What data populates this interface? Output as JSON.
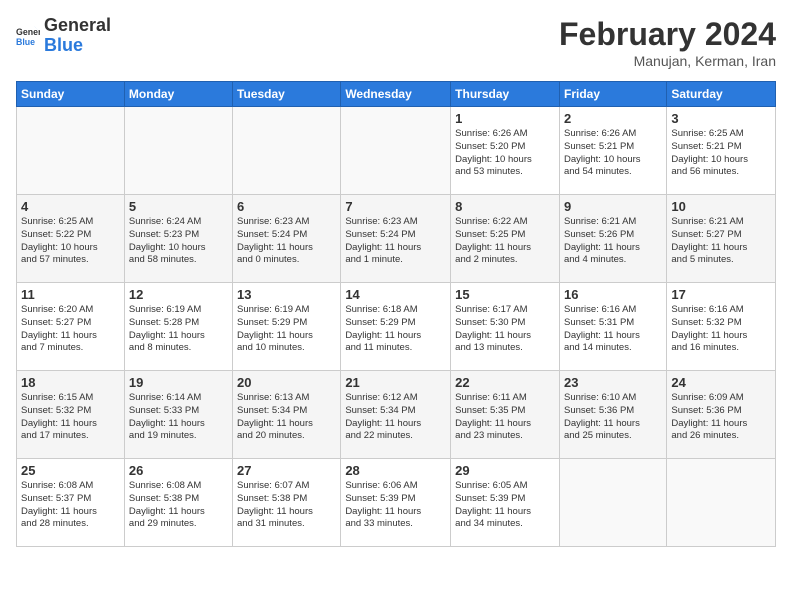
{
  "header": {
    "logo_line1": "General",
    "logo_line2": "Blue",
    "month_title": "February 2024",
    "location": "Manujan, Kerman, Iran"
  },
  "days_of_week": [
    "Sunday",
    "Monday",
    "Tuesday",
    "Wednesday",
    "Thursday",
    "Friday",
    "Saturday"
  ],
  "weeks": [
    [
      {
        "day": "",
        "info": ""
      },
      {
        "day": "",
        "info": ""
      },
      {
        "day": "",
        "info": ""
      },
      {
        "day": "",
        "info": ""
      },
      {
        "day": "1",
        "info": "Sunrise: 6:26 AM\nSunset: 5:20 PM\nDaylight: 10 hours\nand 53 minutes."
      },
      {
        "day": "2",
        "info": "Sunrise: 6:26 AM\nSunset: 5:21 PM\nDaylight: 10 hours\nand 54 minutes."
      },
      {
        "day": "3",
        "info": "Sunrise: 6:25 AM\nSunset: 5:21 PM\nDaylight: 10 hours\nand 56 minutes."
      }
    ],
    [
      {
        "day": "4",
        "info": "Sunrise: 6:25 AM\nSunset: 5:22 PM\nDaylight: 10 hours\nand 57 minutes."
      },
      {
        "day": "5",
        "info": "Sunrise: 6:24 AM\nSunset: 5:23 PM\nDaylight: 10 hours\nand 58 minutes."
      },
      {
        "day": "6",
        "info": "Sunrise: 6:23 AM\nSunset: 5:24 PM\nDaylight: 11 hours\nand 0 minutes."
      },
      {
        "day": "7",
        "info": "Sunrise: 6:23 AM\nSunset: 5:24 PM\nDaylight: 11 hours\nand 1 minute."
      },
      {
        "day": "8",
        "info": "Sunrise: 6:22 AM\nSunset: 5:25 PM\nDaylight: 11 hours\nand 2 minutes."
      },
      {
        "day": "9",
        "info": "Sunrise: 6:21 AM\nSunset: 5:26 PM\nDaylight: 11 hours\nand 4 minutes."
      },
      {
        "day": "10",
        "info": "Sunrise: 6:21 AM\nSunset: 5:27 PM\nDaylight: 11 hours\nand 5 minutes."
      }
    ],
    [
      {
        "day": "11",
        "info": "Sunrise: 6:20 AM\nSunset: 5:27 PM\nDaylight: 11 hours\nand 7 minutes."
      },
      {
        "day": "12",
        "info": "Sunrise: 6:19 AM\nSunset: 5:28 PM\nDaylight: 11 hours\nand 8 minutes."
      },
      {
        "day": "13",
        "info": "Sunrise: 6:19 AM\nSunset: 5:29 PM\nDaylight: 11 hours\nand 10 minutes."
      },
      {
        "day": "14",
        "info": "Sunrise: 6:18 AM\nSunset: 5:29 PM\nDaylight: 11 hours\nand 11 minutes."
      },
      {
        "day": "15",
        "info": "Sunrise: 6:17 AM\nSunset: 5:30 PM\nDaylight: 11 hours\nand 13 minutes."
      },
      {
        "day": "16",
        "info": "Sunrise: 6:16 AM\nSunset: 5:31 PM\nDaylight: 11 hours\nand 14 minutes."
      },
      {
        "day": "17",
        "info": "Sunrise: 6:16 AM\nSunset: 5:32 PM\nDaylight: 11 hours\nand 16 minutes."
      }
    ],
    [
      {
        "day": "18",
        "info": "Sunrise: 6:15 AM\nSunset: 5:32 PM\nDaylight: 11 hours\nand 17 minutes."
      },
      {
        "day": "19",
        "info": "Sunrise: 6:14 AM\nSunset: 5:33 PM\nDaylight: 11 hours\nand 19 minutes."
      },
      {
        "day": "20",
        "info": "Sunrise: 6:13 AM\nSunset: 5:34 PM\nDaylight: 11 hours\nand 20 minutes."
      },
      {
        "day": "21",
        "info": "Sunrise: 6:12 AM\nSunset: 5:34 PM\nDaylight: 11 hours\nand 22 minutes."
      },
      {
        "day": "22",
        "info": "Sunrise: 6:11 AM\nSunset: 5:35 PM\nDaylight: 11 hours\nand 23 minutes."
      },
      {
        "day": "23",
        "info": "Sunrise: 6:10 AM\nSunset: 5:36 PM\nDaylight: 11 hours\nand 25 minutes."
      },
      {
        "day": "24",
        "info": "Sunrise: 6:09 AM\nSunset: 5:36 PM\nDaylight: 11 hours\nand 26 minutes."
      }
    ],
    [
      {
        "day": "25",
        "info": "Sunrise: 6:08 AM\nSunset: 5:37 PM\nDaylight: 11 hours\nand 28 minutes."
      },
      {
        "day": "26",
        "info": "Sunrise: 6:08 AM\nSunset: 5:38 PM\nDaylight: 11 hours\nand 29 minutes."
      },
      {
        "day": "27",
        "info": "Sunrise: 6:07 AM\nSunset: 5:38 PM\nDaylight: 11 hours\nand 31 minutes."
      },
      {
        "day": "28",
        "info": "Sunrise: 6:06 AM\nSunset: 5:39 PM\nDaylight: 11 hours\nand 33 minutes."
      },
      {
        "day": "29",
        "info": "Sunrise: 6:05 AM\nSunset: 5:39 PM\nDaylight: 11 hours\nand 34 minutes."
      },
      {
        "day": "",
        "info": ""
      },
      {
        "day": "",
        "info": ""
      }
    ]
  ]
}
